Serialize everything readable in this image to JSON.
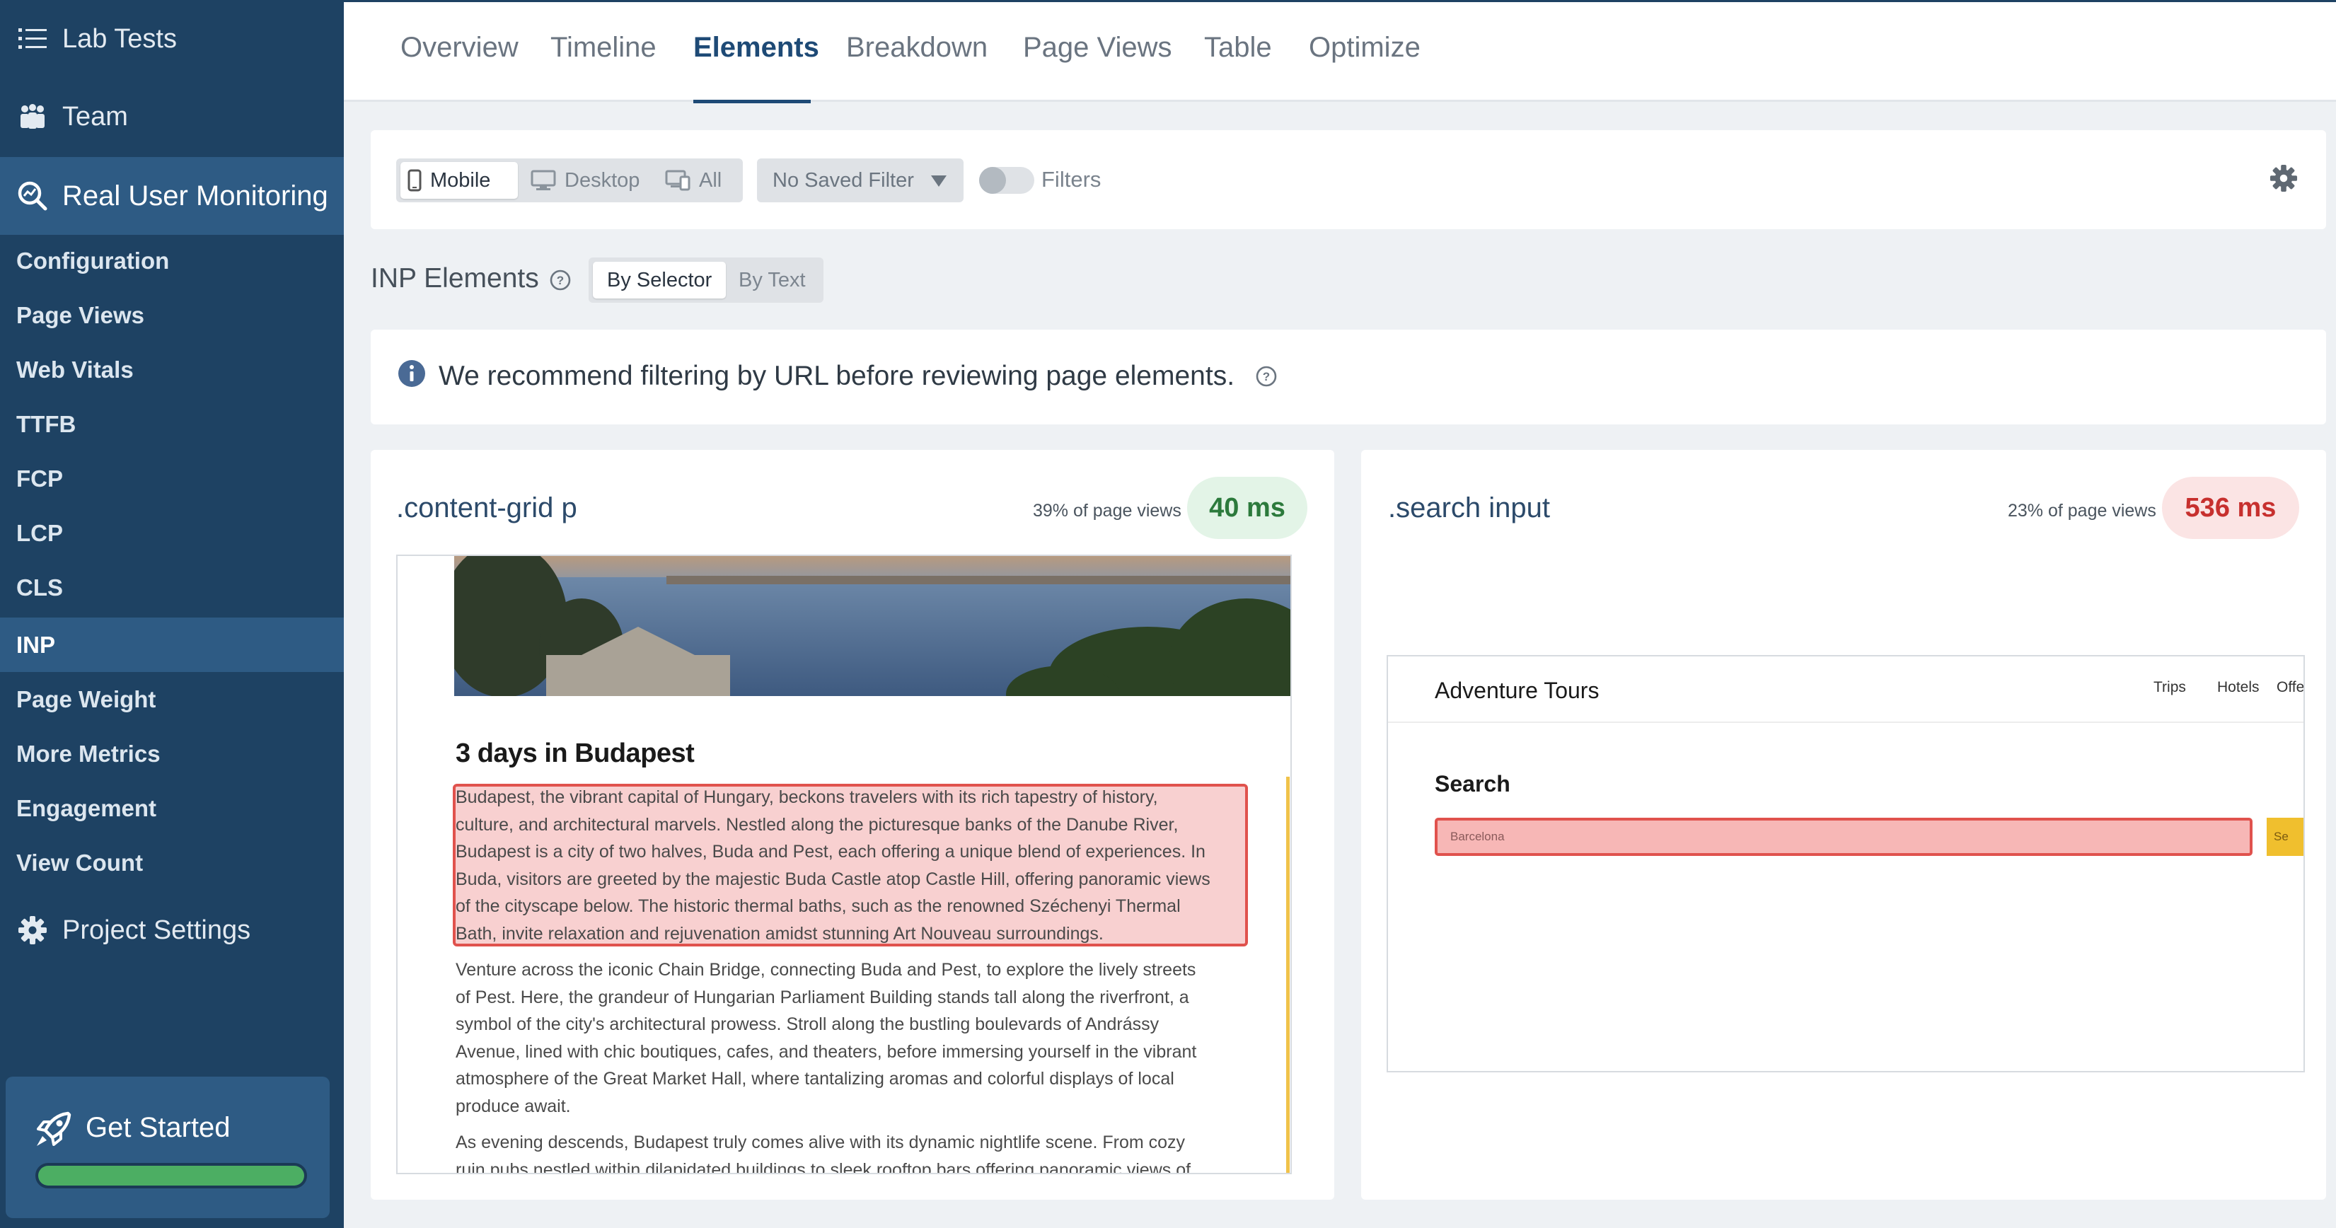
{
  "sidebar": {
    "top_items": [
      {
        "label": "Lab Tests",
        "icon": "list-icon"
      },
      {
        "label": "Team",
        "icon": "team-icon"
      }
    ],
    "rum": {
      "label": "Real User Monitoring",
      "icon": "magnify-chart-icon"
    },
    "sub_items": [
      {
        "label": "Configuration"
      },
      {
        "label": "Page Views"
      },
      {
        "label": "Web Vitals"
      },
      {
        "label": "TTFB"
      },
      {
        "label": "FCP"
      },
      {
        "label": "LCP"
      },
      {
        "label": "CLS"
      },
      {
        "label": "INP",
        "active": true
      },
      {
        "label": "Page Weight"
      },
      {
        "label": "More Metrics"
      },
      {
        "label": "Engagement"
      },
      {
        "label": "View Count"
      }
    ],
    "project_settings": {
      "label": "Project Settings",
      "icon": "gear-icon"
    },
    "get_started": {
      "label": "Get Started",
      "progress": 1.0,
      "progress_color": "#4cae63"
    }
  },
  "tabs": [
    {
      "label": "Overview"
    },
    {
      "label": "Timeline"
    },
    {
      "label": "Elements",
      "active": true
    },
    {
      "label": "Breakdown"
    },
    {
      "label": "Page Views"
    },
    {
      "label": "Table"
    },
    {
      "label": "Optimize"
    }
  ],
  "filters": {
    "devices": [
      {
        "label": "Mobile",
        "icon": "mobile-icon",
        "active": true
      },
      {
        "label": "Desktop",
        "icon": "desktop-icon"
      },
      {
        "label": "All",
        "icon": "all-devices-icon"
      }
    ],
    "saved_filter": "No Saved Filter",
    "toggle_label": "Filters",
    "toggle_on": false
  },
  "inp": {
    "title": "INP Elements",
    "modes": [
      {
        "label": "By Selector",
        "active": true
      },
      {
        "label": "By Text"
      }
    ]
  },
  "notice": {
    "message": "We recommend filtering by URL before reviewing page elements."
  },
  "cards": [
    {
      "selector": ".content-grid p",
      "share": "39% of page views",
      "inp": "40 ms",
      "status": "good",
      "preview": {
        "title": "3 days in Budapest",
        "paragraphs": [
          [
            "Budapest, the vibrant capital of Hungary, beckons travelers with its rich tapestry of history,",
            "culture, and architectural marvels. Nestled along the picturesque banks of the Danube River,",
            "Budapest is a city of two halves, Buda and Pest, each offering a unique blend of experiences. In",
            "Buda, visitors are greeted by the majestic Buda Castle atop Castle Hill, offering panoramic views",
            "of the cityscape below. The historic thermal baths, such as the renowned Széchenyi Thermal",
            "Bath, invite relaxation and rejuvenation amidst stunning Art Nouveau surroundings."
          ],
          [
            "Venture across the iconic Chain Bridge, connecting Buda and Pest, to explore the lively streets",
            "of Pest. Here, the grandeur of Hungarian Parliament Building stands tall along the riverfront, a",
            "symbol of the city's architectural prowess. Stroll along the bustling boulevards of Andrássy",
            "Avenue, lined with chic boutiques, cafes, and theaters, before immersing yourself in the vibrant",
            "atmosphere of the Great Market Hall, where tantalizing aromas and colorful displays of local",
            "produce await."
          ],
          [
            "As evening descends, Budapest truly comes alive with its dynamic nightlife scene. From cozy",
            "ruin pubs nestled within dilapidated buildings to sleek rooftop bars offering panoramic views of"
          ]
        ]
      }
    },
    {
      "selector": ".search input",
      "share": "23% of page views",
      "inp": "536 ms",
      "status": "poor",
      "preview": {
        "brand": "Adventure Tours",
        "nav": [
          "Trips",
          "Hotels",
          "Offers"
        ],
        "heading": "Search",
        "input_value": "Barcelona",
        "button_label": "Se"
      }
    }
  ]
}
